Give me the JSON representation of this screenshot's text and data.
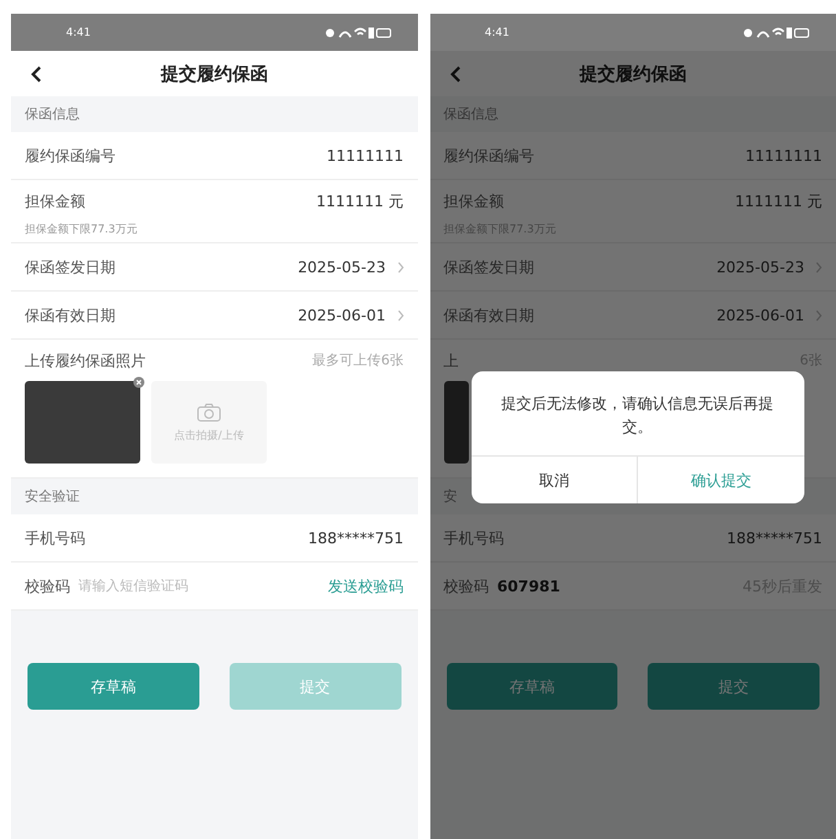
{
  "screens": [
    {
      "dimmed": false,
      "status_time": "4:41",
      "title": "提交履约保函",
      "rows": [
        {
          "kind": "header",
          "label": "保函信息"
        },
        {
          "kind": "field",
          "label": "履约保函编号",
          "value": "11111111",
          "chevron": false
        },
        {
          "kind": "field",
          "label": "担保金额",
          "value": "1111111 元",
          "chevron": false,
          "note": "担保金额下限77.3万元"
        },
        {
          "kind": "field",
          "label": "保函签发日期",
          "value": "2025-05-23",
          "chevron": true
        },
        {
          "kind": "field",
          "label": "保函有效日期",
          "value": "2025-06-01",
          "chevron": true
        },
        {
          "kind": "upload",
          "label": "上传履约保函照片",
          "hint": "最多可上传6张",
          "photo": true,
          "add_label": "点击拍摄/上传"
        },
        {
          "kind": "header",
          "label": "安全验证"
        },
        {
          "kind": "field",
          "label": "手机号码",
          "value": "188*****751",
          "chevron": false
        },
        {
          "kind": "code",
          "label": "校验码",
          "placeholder": "请输入短信验证码",
          "action": "发送校验码",
          "action_active": true
        }
      ],
      "buttons": [
        {
          "label": "存草稿",
          "disabled": false
        },
        {
          "label": "提交",
          "disabled": true
        }
      ]
    },
    {
      "dimmed": true,
      "status_time": "4:41",
      "title": "提交履约保函",
      "rows": [
        {
          "kind": "header",
          "label": "保函信息"
        },
        {
          "kind": "field",
          "label": "履约保函编号",
          "value": "11111111",
          "chevron": false
        },
        {
          "kind": "field",
          "label": "担保金额",
          "value": "1111111 元",
          "chevron": false,
          "note": "担保金额下限77.3万元"
        },
        {
          "kind": "field",
          "label": "保函签发日期",
          "value": "2025-05-23",
          "chevron": true
        },
        {
          "kind": "field",
          "label": "保函有效日期",
          "value": "2025-06-01",
          "chevron": true
        },
        {
          "kind": "upload",
          "label": "上",
          "hint": "6张",
          "photo": true
        },
        {
          "kind": "header",
          "label": "安"
        },
        {
          "kind": "field",
          "label": "手机号码",
          "value": "188*****751",
          "chevron": false
        },
        {
          "kind": "code",
          "label": "校验码",
          "value": "607981",
          "action": "45秒后重发",
          "action_active": false
        }
      ],
      "buttons": [
        {
          "label": "存草稿",
          "disabled": false
        },
        {
          "label": "提交",
          "disabled": false
        }
      ],
      "dialog": {
        "message": "提交后无法修改，请确认信息无误后再提交。",
        "buttons": [
          {
            "label": "取消",
            "primary": false
          },
          {
            "label": "确认提交",
            "primary": true
          }
        ]
      }
    }
  ]
}
